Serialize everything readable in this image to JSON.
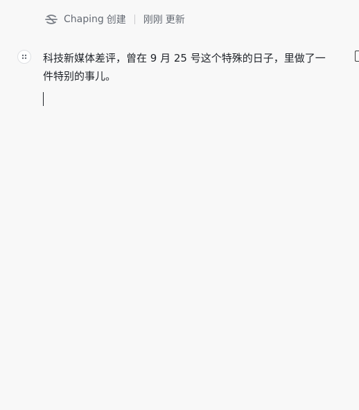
{
  "meta": {
    "author_name": "Chaping",
    "created_label": "创建",
    "updated_time": "刚刚",
    "updated_label": "更新",
    "author_icon": "chaping-logo-icon"
  },
  "document": {
    "paragraph_lines": "科技新媒体差评，曾在 9 月 25 号这个特殊的日子，里做了一\n件特别的事儿。"
  },
  "block": {
    "handle_icon": "drag-handle-icon"
  },
  "colors": {
    "background": "#f8f8f8",
    "text": "#1f2329",
    "meta_text": "#646a73"
  }
}
